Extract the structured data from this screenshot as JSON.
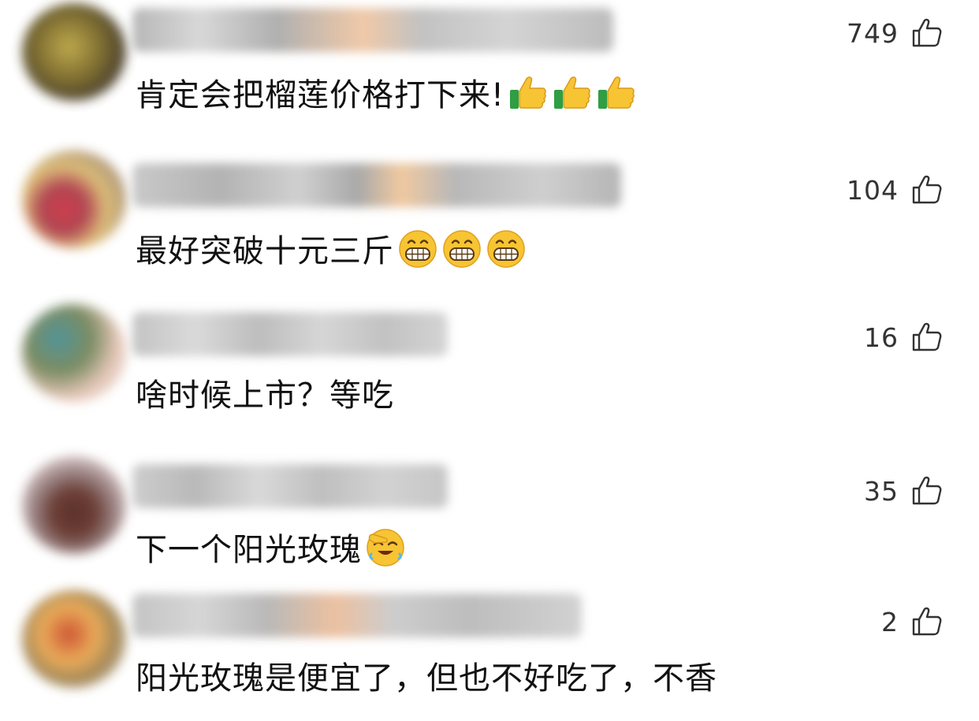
{
  "colors": {
    "text": "#111111",
    "like_count": "#333333",
    "like_icon": "#333333",
    "emoji_yellow": "#f7c434",
    "thumb_cuff": "#2f9e44"
  },
  "comments": [
    {
      "text": "肯定会把榴莲价格打下来!",
      "likes": "749",
      "emoji_icon": "thumbs-up-icon",
      "emoji_count": 3,
      "avatar_colors": [
        "#6b5a1a",
        "#b9a13a",
        "#3b2f1a"
      ]
    },
    {
      "text": "最好突破十元三斤",
      "likes": "104",
      "emoji_icon": "grinning-face-icon",
      "emoji_count": 3,
      "avatar_colors": [
        "#d9b86a",
        "#cc2a3a",
        "#a58a6b"
      ]
    },
    {
      "text": "啥时候上市？等吃",
      "likes": "16",
      "emoji_icon": "none",
      "emoji_count": 0,
      "avatar_colors": [
        "#3f8a8e",
        "#6d7f52",
        "#e6c3b3"
      ]
    },
    {
      "text": "下一个阳光玫瑰",
      "likes": "35",
      "emoji_icon": "facepalm-laugh-icon",
      "emoji_count": 1,
      "avatar_colors": [
        "#c9b3b3",
        "#4a1c15",
        "#8a7070"
      ]
    },
    {
      "text": "阳光玫瑰是便宜了，但也不好吃了，不香",
      "likes": "2",
      "emoji_icon": "none",
      "emoji_count": 0,
      "avatar_colors": [
        "#e7a347",
        "#c8421e",
        "#9a7c48"
      ]
    }
  ]
}
